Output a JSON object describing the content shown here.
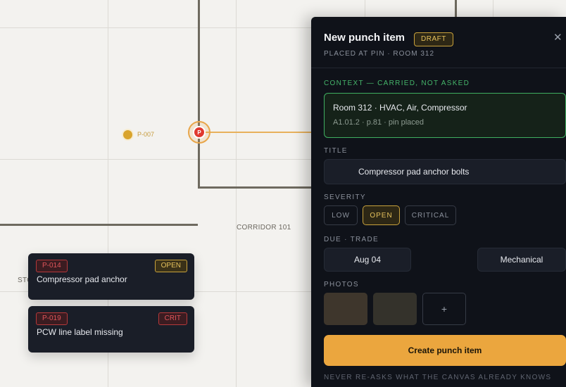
{
  "canvas": {
    "room_label": "CORRIDOR 101",
    "partial_label": "STO",
    "pin_secondary_label": "P-007",
    "pin_active_letter": "P"
  },
  "cards": [
    {
      "id": "P-014",
      "status": "OPEN",
      "title": "Compressor pad anchor"
    },
    {
      "id": "P-019",
      "status": "CRIT",
      "title": "PCW line label missing"
    }
  ],
  "panel": {
    "title": "New punch item",
    "badge": "DRAFT",
    "close_glyph": "✕",
    "subtitle": "PLACED AT PIN · ROOM 312",
    "context_label": "CONTEXT — CARRIED, NOT ASKED",
    "context_line1": "Room 312 · HVAC, Air, Compressor",
    "context_line2": "A1.01.2 · p.81 · pin placed",
    "title_label": "TITLE",
    "title_value": "Compressor pad anchor bolts",
    "severity_label": "SEVERITY",
    "severity_options": [
      "LOW",
      "OPEN",
      "CRITICAL"
    ],
    "severity_selected": "OPEN",
    "due_trade_label": "DUE · TRADE",
    "due_value": "Aug 04",
    "trade_value": "Mechanical",
    "photos_label": "PHOTOS",
    "add_photo_glyph": "+",
    "create_label": "Create punch item",
    "footer_note": "NEVER RE-ASKS WHAT THE CANVAS ALREADY KNOWS"
  },
  "colors": {
    "accent": "#eba63e",
    "context_green": "#3fae60",
    "critical_red": "#e0392f",
    "draft_gold": "#e6c25c"
  },
  "icons": [
    "close-icon",
    "add-photo-icon",
    "pin-icon"
  ]
}
